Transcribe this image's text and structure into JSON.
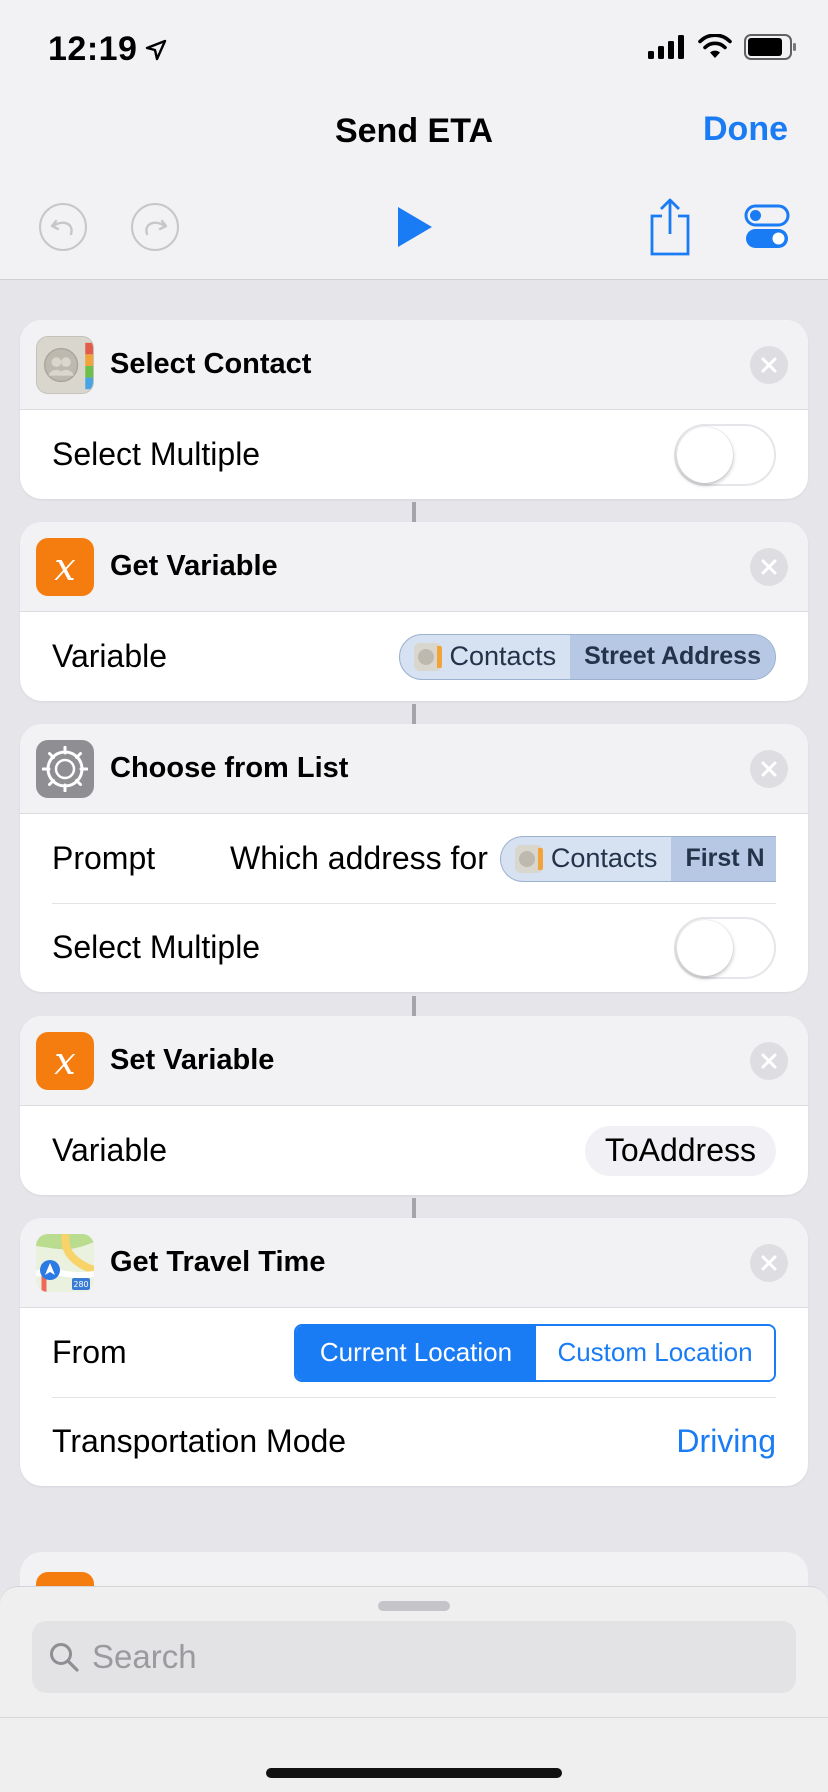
{
  "status_bar": {
    "time": "12:19"
  },
  "nav": {
    "title": "Send ETA",
    "done_label": "Done"
  },
  "actions": {
    "select_contact": {
      "title": "Select Contact",
      "select_multiple_label": "Select Multiple",
      "select_multiple_on": false
    },
    "get_variable": {
      "title": "Get Variable",
      "variable_label": "Variable",
      "token_source": "Contacts",
      "token_property": "Street Address"
    },
    "choose_from_list": {
      "title": "Choose from List",
      "prompt_label": "Prompt",
      "prompt_text": "Which address for",
      "token_source": "Contacts",
      "token_property": "First N",
      "select_multiple_label": "Select Multiple",
      "select_multiple_on": false
    },
    "set_variable": {
      "title": "Set Variable",
      "variable_label": "Variable",
      "variable_value": "ToAddress"
    },
    "get_travel_time": {
      "title": "Get Travel Time",
      "from_label": "From",
      "from_options": [
        "Current Location",
        "Custom Location"
      ],
      "from_selected": "Current Location",
      "mode_label": "Transportation Mode",
      "mode_value": "Driving",
      "map_badge": "280"
    }
  },
  "search": {
    "placeholder": "Search"
  },
  "colors": {
    "accent": "#1a7cf5",
    "variable_orange": "#f57d0f"
  }
}
